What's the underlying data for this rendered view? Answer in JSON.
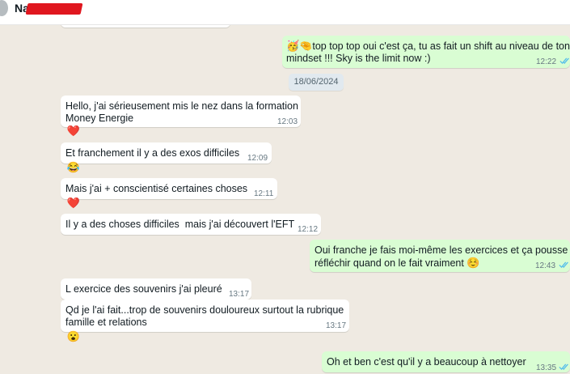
{
  "header": {
    "contact_name": "Na"
  },
  "date_separator": "18/06/2024",
  "messages": [
    {
      "direction": "out",
      "emoji_prefix": "🥳🤏",
      "line1": "top top top oui c'est ça, tu as fait un shift au niveau de ton",
      "line2": "mindset !!! Sky is the limit now :)",
      "time": "12:22",
      "read": true
    },
    {
      "direction": "in",
      "line1": "Hello, j'ai sérieusement mis le nez dans la formation",
      "line2": "Money Energie",
      "time": "12:03",
      "reaction": "❤️"
    },
    {
      "direction": "in",
      "line1": "Et franchement il y a des exos difficiles",
      "time": "12:09",
      "reaction": "😂"
    },
    {
      "direction": "in",
      "line1": "Mais j'ai + conscientisé certaines choses",
      "time": "12:11",
      "reaction": "❤️"
    },
    {
      "direction": "in",
      "line1": "Il y a des choses difficiles  mais j'ai découvert l'EFT",
      "time": "12:12"
    },
    {
      "direction": "out",
      "line1": "Oui franche je fais moi-même les exercices et ça pousse à",
      "line2": "réfléchir quand on le fait vraiment",
      "emoji_suffix": "☺️",
      "time": "12:43",
      "read": true
    },
    {
      "direction": "in",
      "line1": "L exercice des souvenirs j'ai pleuré",
      "time": "13:17"
    },
    {
      "direction": "in",
      "line1": "Qd je l'ai fait...trop de souvenirs douloureux surtout la rubrique",
      "line2": "famille et relations",
      "time": "13:17",
      "reaction": "😮"
    },
    {
      "direction": "out",
      "line1": "Oh et ben c'est qu'il y a beaucoup à nettoyer",
      "time": "13:35",
      "read": true
    }
  ],
  "colors": {
    "chat_background": "#efeae2",
    "incoming_bubble": "#ffffff",
    "outgoing_bubble": "#d9fdd3",
    "read_ticks": "#53bdeb",
    "timestamp": "#667781"
  },
  "icons": {
    "read_receipt": "double-check-icon"
  }
}
